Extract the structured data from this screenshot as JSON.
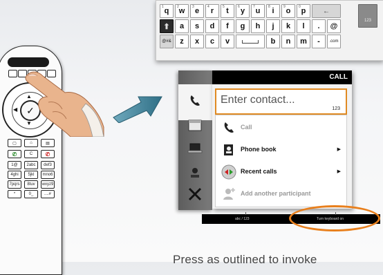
{
  "keyboard": {
    "rows": [
      [
        {
          "k": "q",
          "s": "1"
        },
        {
          "k": "w",
          "s": "2"
        },
        {
          "k": "e",
          "s": "3"
        },
        {
          "k": "r",
          "s": "4"
        },
        {
          "k": "t",
          "s": "5"
        },
        {
          "k": "y",
          "s": "6"
        },
        {
          "k": "u",
          "s": "7"
        },
        {
          "k": "i",
          "s": "8"
        },
        {
          "k": "o",
          "s": "9"
        },
        {
          "k": "p",
          "s": "0"
        }
      ],
      [
        {
          "k": "a"
        },
        {
          "k": "s"
        },
        {
          "k": "d"
        },
        {
          "k": "f"
        },
        {
          "k": "g"
        },
        {
          "k": "h"
        },
        {
          "k": "j"
        },
        {
          "k": "k"
        },
        {
          "k": "l"
        },
        {
          "k": "."
        },
        {
          "k": "@"
        }
      ],
      [
        {
          "k": "z"
        },
        {
          "k": "x"
        },
        {
          "k": "c"
        },
        {
          "k": "v"
        },
        {
          "k": "b"
        },
        {
          "k": "n"
        },
        {
          "k": "m"
        },
        {
          "k": "-"
        }
      ]
    ],
    "backspace": "←",
    "shift": "⬆",
    "symbol_key": "@#&",
    "dotcom_key": ".com",
    "mode_key": "123"
  },
  "remote": {
    "ok_symbol": "✓",
    "keypad": [
      [
        "1@",
        "2abc",
        "def3"
      ],
      [
        "4ghi",
        "5jkl",
        "mno6"
      ],
      [
        "7pqrs",
        "8tuv",
        "wxyz9"
      ],
      [
        "*",
        "0_",
        "....#"
      ]
    ]
  },
  "call_panel": {
    "title": "CALL",
    "contact_placeholder": "Enter contact...",
    "input_mode": "123",
    "menu": {
      "call": "Call",
      "phone_book": "Phone book",
      "recent_calls": "Recent calls",
      "add_participant": "Add another participant",
      "submenu_arrow": "▶"
    }
  },
  "softkeys": {
    "left": "abc / 123",
    "right": "Turn keyboard on"
  },
  "caption": "Press as outlined to invoke",
  "colors": {
    "highlight": "#e87f1c",
    "arrow": "#3f7f94"
  }
}
